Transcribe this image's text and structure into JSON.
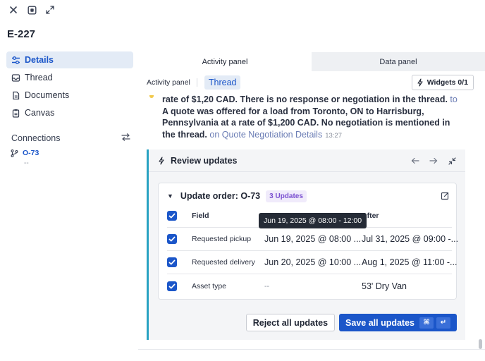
{
  "window": {
    "icons": [
      "close-icon",
      "screen-icon",
      "expand-icon"
    ],
    "title": "E-227"
  },
  "sidebar": {
    "items": [
      {
        "label": "Details",
        "icon": "sliders-icon",
        "active": true
      },
      {
        "label": "Thread",
        "icon": "inbox-icon",
        "active": false
      },
      {
        "label": "Documents",
        "icon": "document-icon",
        "active": false
      },
      {
        "label": "Canvas",
        "icon": "clipboard-icon",
        "active": false
      }
    ],
    "connections": {
      "label": "Connections",
      "items": [
        {
          "label": "O-73",
          "sub": "--",
          "icon": "branch-icon"
        }
      ]
    }
  },
  "main": {
    "tabs": [
      {
        "label": "Activity panel",
        "active": true
      },
      {
        "label": "Data panel",
        "active": false
      }
    ],
    "subbar": {
      "label": "Activity panel",
      "pill": "Thread",
      "widgets_button": "Widgets 0/1"
    },
    "message": {
      "text_bold": "rate of $1,20 CAD. There is no response or negotiation in the thread.",
      "link1": " to",
      "text_bold2": " A quote was offered for a load from Toronto, ON to Harrisburg, Pennsylvania at a rate of $1,200 CAD. No negotiation is mentioned in the thread.",
      "link2": " on Quote Negotiation Details",
      "time": "13:27"
    },
    "review": {
      "title": "Review updates",
      "order": {
        "title": "Update order: O-73",
        "badge": "3 Updates",
        "columns": {
          "field": "Field",
          "before": "",
          "after": "After"
        },
        "rows": [
          {
            "field": "Requested pickup",
            "before": "Jun 19, 2025 @ 08:00 ...",
            "after": "Jul 31, 2025 @ 09:00 -..."
          },
          {
            "field": "Requested delivery",
            "before": "Jun 20, 2025 @ 10:00 ...",
            "after": "Aug 1, 2025 @ 11:00 -..."
          },
          {
            "field": "Asset type",
            "before": "--",
            "after": "53' Dry Van"
          }
        ],
        "tooltip": "Jun 19, 2025 @ 08:00 - 12:00"
      },
      "reject_label": "Reject all updates",
      "save_label": "Save all updates"
    }
  },
  "colors": {
    "accent": "#1b56c9",
    "active_bg": "#e3ebf6",
    "review_border": "#28a2c2",
    "badge_text": "#7a4fd0"
  }
}
